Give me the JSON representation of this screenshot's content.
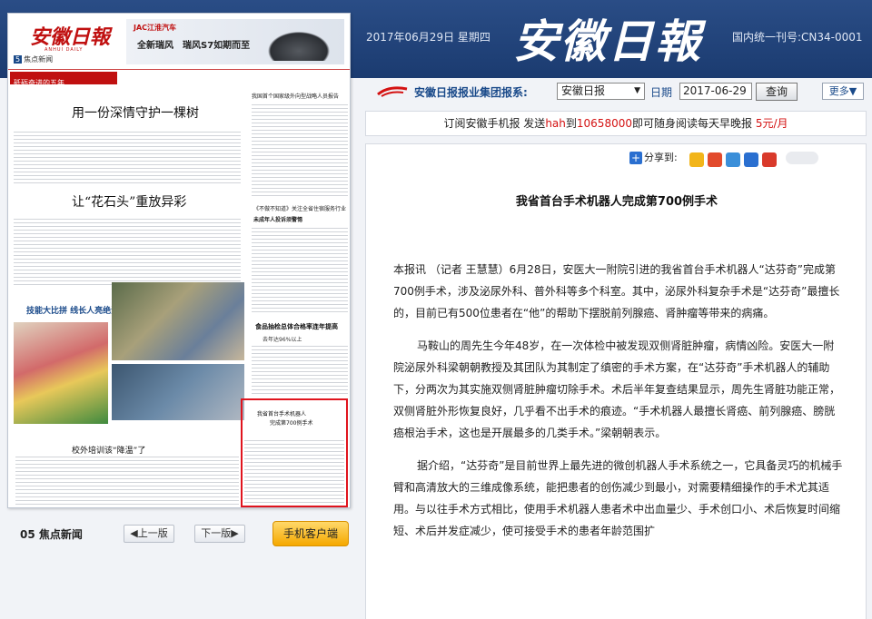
{
  "header": {
    "date": "2017年06月29日  星期四",
    "title": "安徽日報",
    "code": "国内统一刊号:CN34-0001"
  },
  "newspaper": {
    "logo": "安徽日報",
    "logo_sub": "ANHUI DAILY",
    "section_num": "5",
    "section": "焦点新闻",
    "ad_brand": "JAC江淮汽车",
    "ad_line1": "全新瑞风",
    "ad_line2": "瑞风S7如期而至",
    "banner": "砥砺奋进的五年",
    "headline1": "用一份深情守护一棵树",
    "headline2": "让“花石头”重放异彩",
    "headline3": "技能大比拼 线长人亮绝活",
    "headline4": "校外培训该“降温”了",
    "right_title": "我国首个国家级外向型战略人员报告",
    "right_sub1": "《不做不知道》关注全省住宿服务行业",
    "right_sub2": "未成年人投诉须警惕",
    "mid1": "食品抽检总体合格率连年提高",
    "mid2": "去年达96%以上",
    "box_line1": "我省首台手术机器人",
    "box_line2": "完成第700例手术"
  },
  "bottom_bar": {
    "page_label": "05  焦点新闻",
    "prev": "◀上一版",
    "next": "下一版▶",
    "mobile": "手机客户端"
  },
  "toolbar": {
    "group_label": "安徽日报报业集团报系:",
    "paper_select": "安徽日报",
    "date_label": "日期",
    "date_value": "2017-06-29",
    "query": "查询",
    "more": "更多▼"
  },
  "subscription": {
    "part1": "订阅安徽手机报   发送",
    "keyword": "hah",
    "part2": "到",
    "number": "10658000",
    "part3": "即可随身阅读每天早晚报   ",
    "price": "5元/月"
  },
  "article": {
    "share_label": "分享到:",
    "title": "我省首台手术机器人完成第700例手术",
    "paragraphs": [
      "本报讯 （记者 王慧慧）6月28日，安医大一附院引进的我省首台手术机器人“达芬奇”完成第700例手术，涉及泌尿外科、普外科等多个科室。其中，泌尿外科复杂手术是“达芬奇”最擅长的，目前已有500位患者在“他”的帮助下摆脱前列腺癌、肾肿瘤等带来的病痛。",
      "马鞍山的周先生今年48岁，在一次体检中被发现双侧肾脏肿瘤，病情凶险。安医大一附院泌尿外科梁朝朝教授及其团队为其制定了缜密的手术方案，在“达芬奇”手术机器人的辅助下，分两次为其实施双侧肾脏肿瘤切除手术。术后半年复查结果显示，周先生肾脏功能正常，双侧肾脏外形恢复良好，几乎看不出手术的痕迹。“手术机器人最擅长肾癌、前列腺癌、膀胱癌根治手术，这也是开展最多的几类手术。”梁朝朝表示。",
      "据介绍，“达芬奇”是目前世界上最先进的微创机器人手术系统之一，它具备灵巧的机械手臂和高清放大的三维成像系统，能把患者的创伤减少到最小，对需要精细操作的手术尤其适用。与以往手术方式相比，使用手术机器人患者术中出血量少、手术创口小、术后恢复时间缩短、术后并发症减少，使可接受手术的患者年龄范围扩"
    ]
  }
}
